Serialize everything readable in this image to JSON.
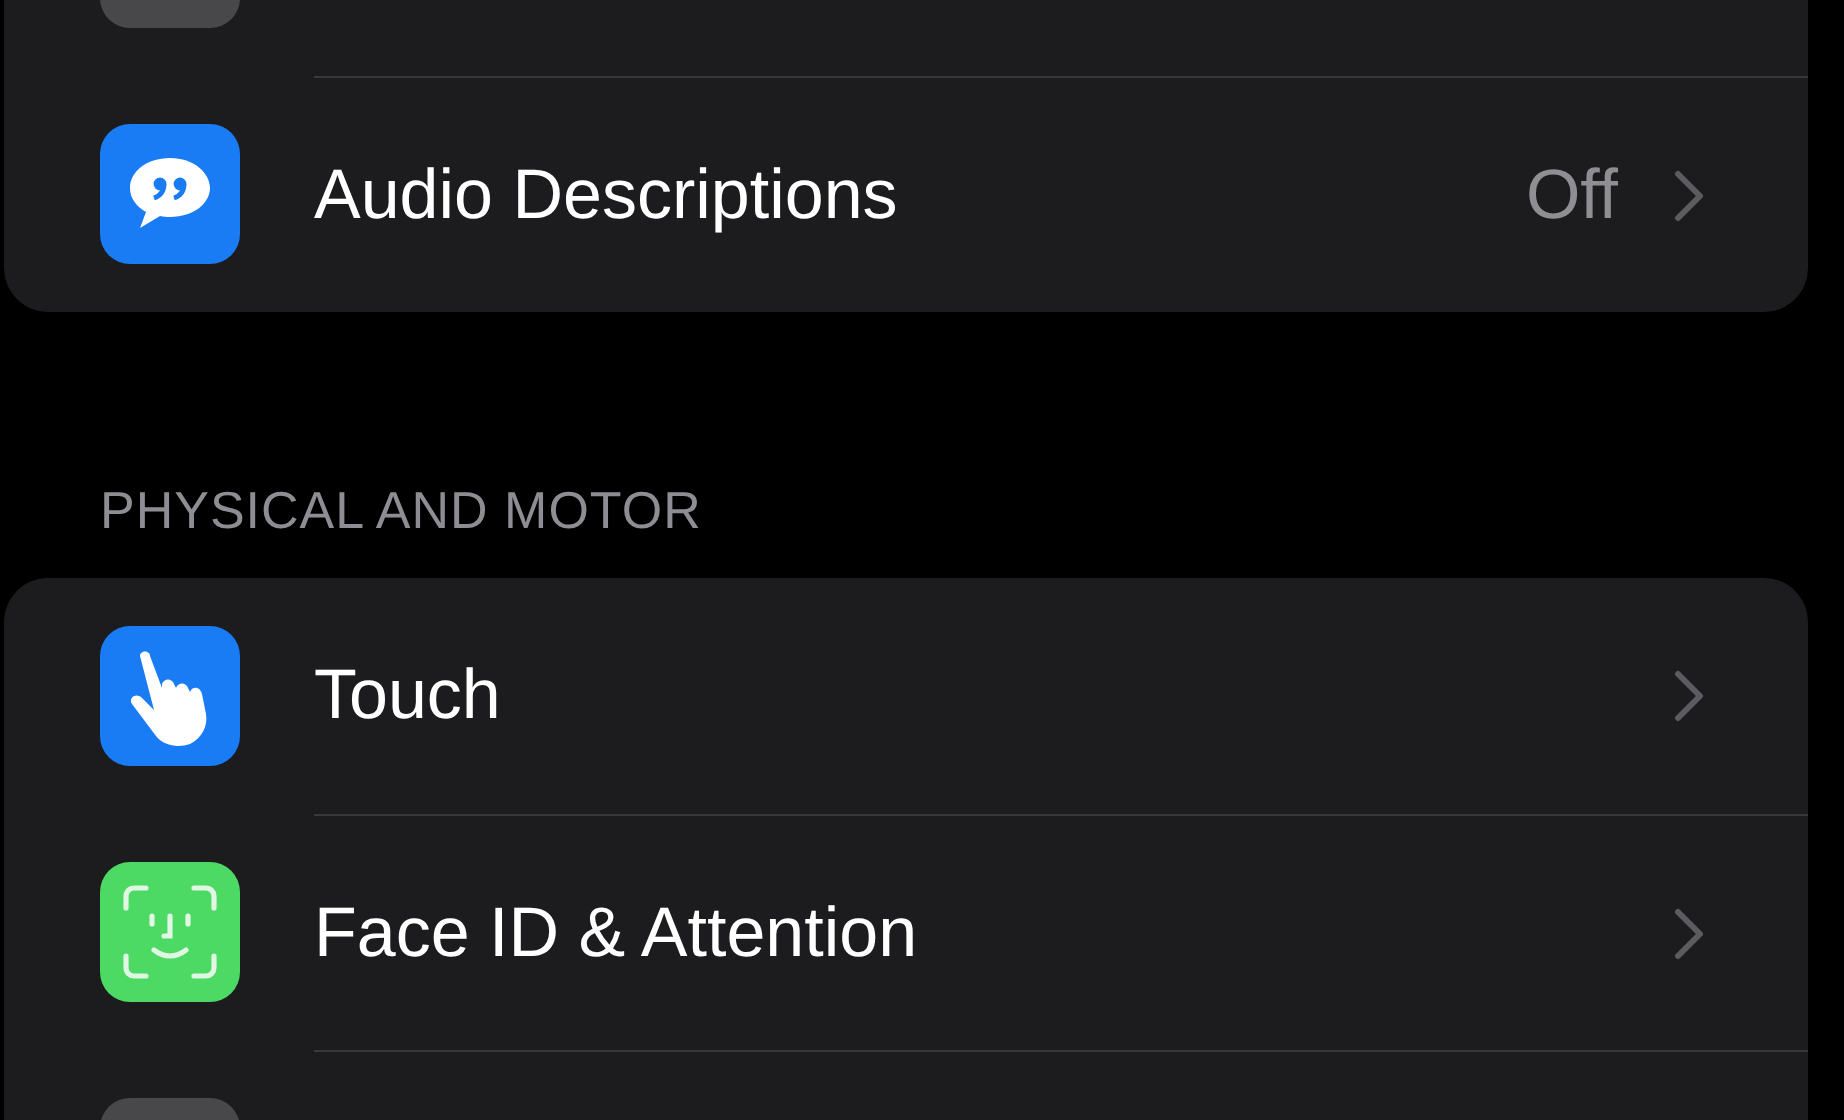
{
  "groups": [
    {
      "rows": [
        {
          "kind": "cut",
          "color": "#48484a"
        },
        {
          "kind": "link",
          "color": "#1a7cf5",
          "label": "Audio Descriptions",
          "value": "Off"
        }
      ]
    },
    {
      "header": "PHYSICAL AND MOTOR",
      "rows": [
        {
          "kind": "link",
          "color": "#1a7cf5",
          "label": "Touch"
        },
        {
          "kind": "link",
          "color": "#4cd964",
          "label": "Face ID & Attention"
        },
        {
          "kind": "cut",
          "color": "#48484a"
        }
      ]
    }
  ]
}
